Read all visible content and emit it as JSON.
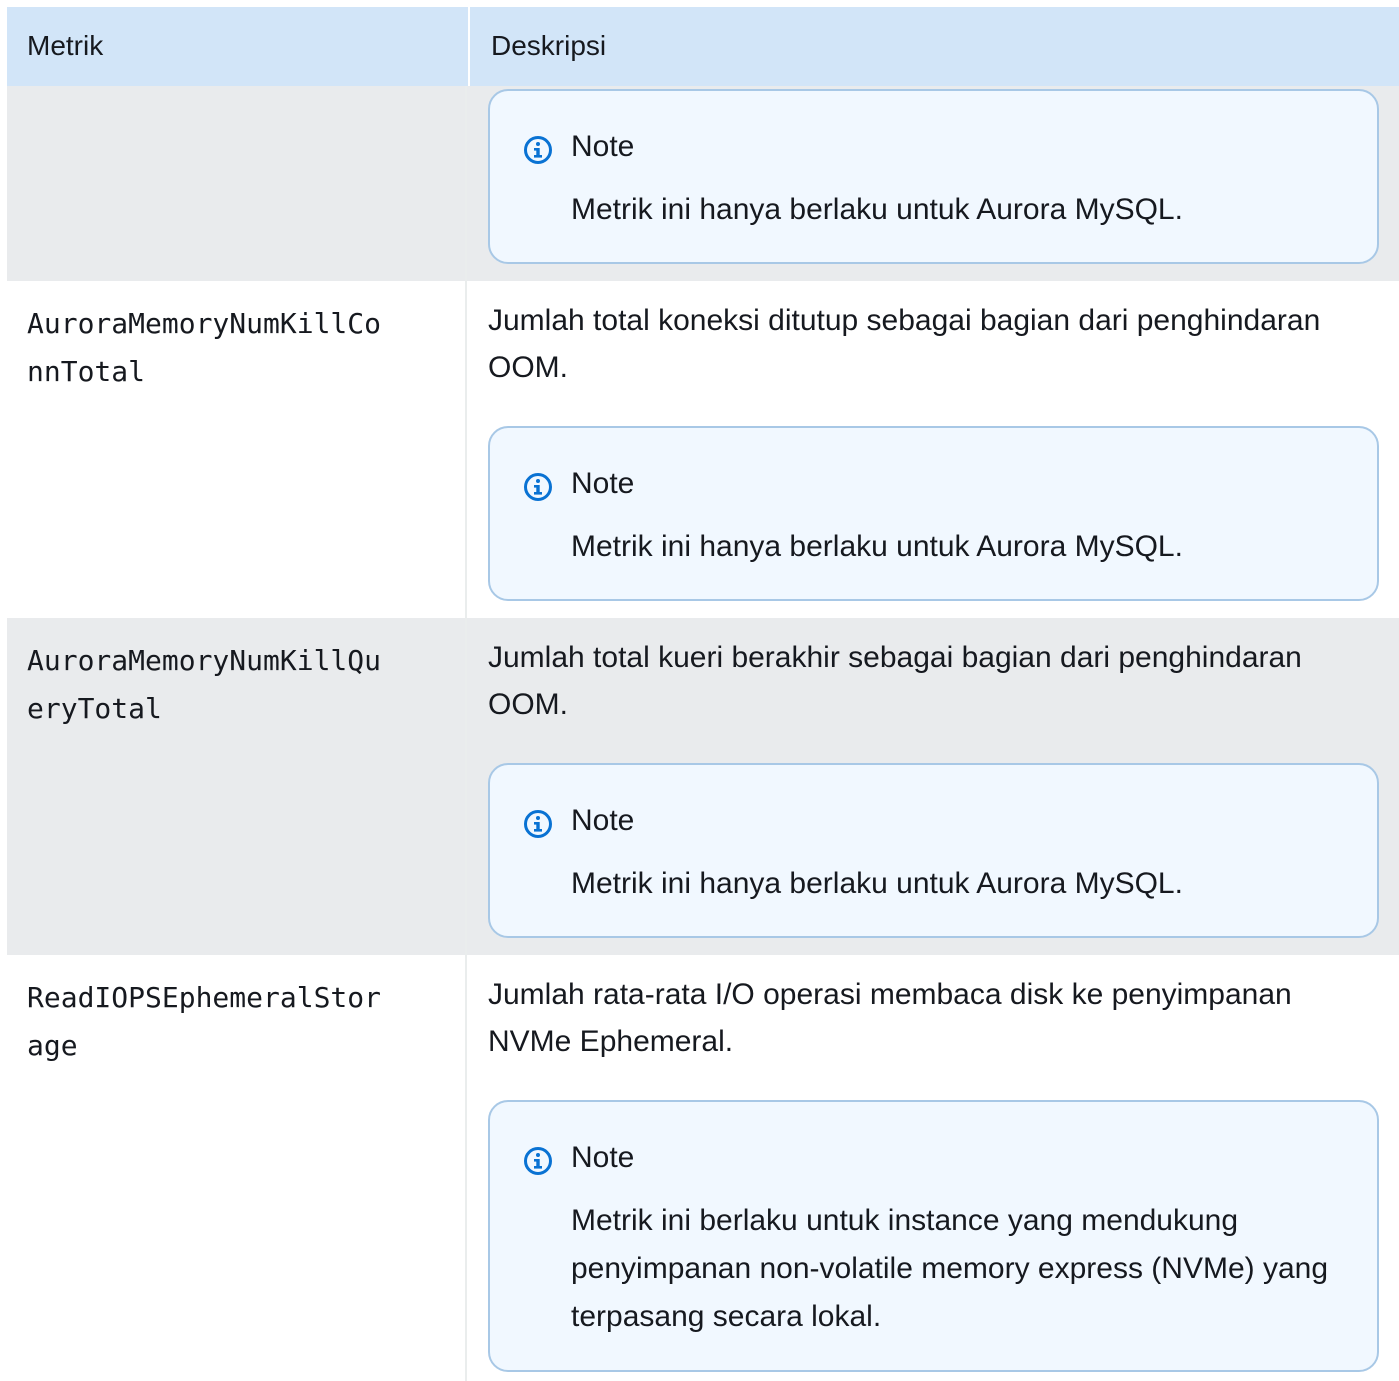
{
  "table": {
    "header": {
      "metric": "Metrik",
      "description": "Deskripsi"
    },
    "rows": [
      {
        "metric": "",
        "description": "",
        "note": {
          "title": "Note",
          "icon": "info-icon",
          "text": "Metrik ini hanya berlaku untuk Aurora MySQL."
        }
      },
      {
        "metric": "AuroraMemoryNumKillConnTotal",
        "description": "Jumlah total koneksi ditutup sebagai bagian dari penghindaran OOM.",
        "note": {
          "title": "Note",
          "icon": "info-icon",
          "text": "Metrik ini hanya berlaku untuk Aurora MySQL."
        }
      },
      {
        "metric": "AuroraMemoryNumKillQueryTotal",
        "description": "Jumlah total kueri berakhir sebagai bagian dari penghindaran OOM.",
        "note": {
          "title": "Note",
          "icon": "info-icon",
          "text": "Metrik ini hanya berlaku untuk Aurora MySQL."
        }
      },
      {
        "metric": "ReadIOPSEphemeralStorage",
        "description": "Jumlah rata-rata I/O operasi membaca disk ke penyimpanan NVMe Ephemeral.",
        "note": {
          "title": "Note",
          "icon": "info-icon",
          "text": "Metrik ini berlaku untuk instance yang mendukung penyimpanan non-volatile memory express (NVMe) yang terpasang secara lokal."
        }
      }
    ]
  },
  "colors": {
    "header_bg": "#d2e5f8",
    "row_alt_bg": "#e9ebed",
    "note_bg": "#f1f8ff",
    "note_border": "#a8c8e6",
    "info_icon": "#0972d3"
  }
}
